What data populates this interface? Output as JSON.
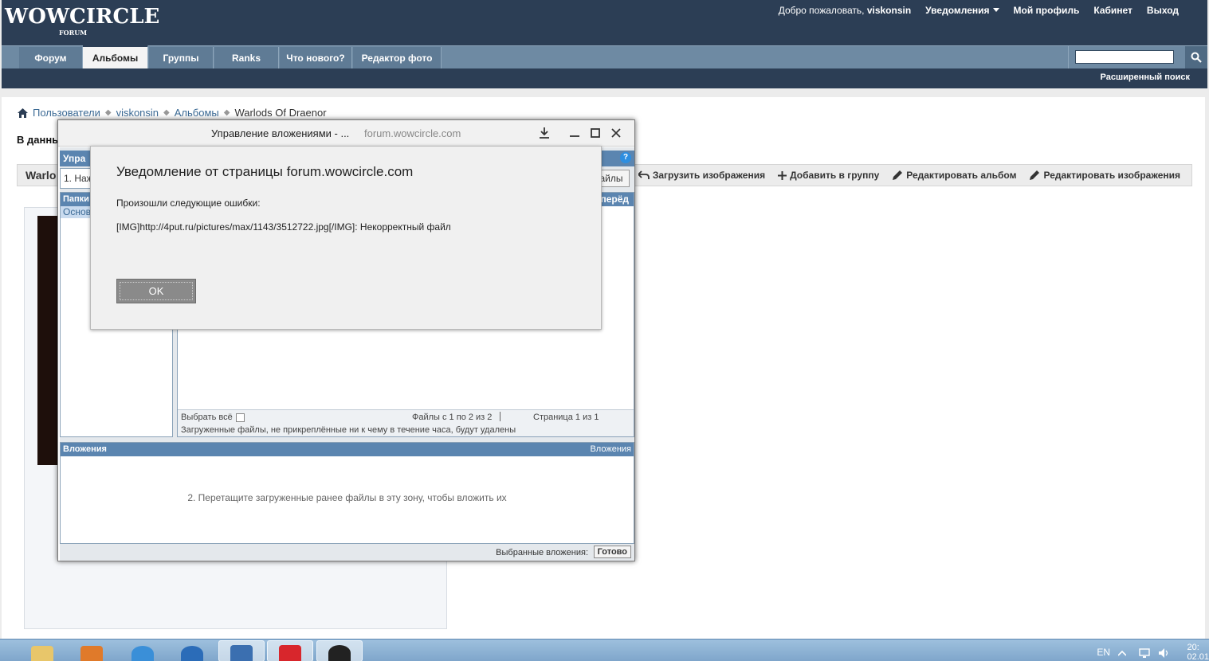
{
  "header": {
    "logo": "WOWCIRCLE",
    "logo_sub": "FORUM",
    "welcome_prefix": "Добро пожаловать,",
    "username": "viskonsin",
    "notifications": "Уведомления",
    "my_profile": "Мой профиль",
    "cabinet": "Кабинет",
    "logout": "Выход"
  },
  "nav": {
    "tabs": [
      {
        "label": "Форум"
      },
      {
        "label": "Альбомы"
      },
      {
        "label": "Группы"
      },
      {
        "label": "Ranks"
      },
      {
        "label": "Что нового?"
      },
      {
        "label": "Редактор фото"
      }
    ],
    "advanced_search": "Расширенный поиск"
  },
  "breadcrumb": {
    "items": [
      "Пользователи",
      "viskonsin",
      "Альбомы",
      "Warlods Of Draenor"
    ]
  },
  "page": {
    "intro": "В данны",
    "album_title": "Warlo",
    "actions": {
      "upload": "Загрузить изображения",
      "add_group": "Добавить в группу",
      "edit_album": "Редактировать альбом",
      "edit_images": "Редактировать изображения"
    }
  },
  "attach_window": {
    "title": "Управление вложениями - ...",
    "url": "forum.wowcircle.com",
    "manage_head": "Упра",
    "step1": "1. Наж",
    "files_button": "айлы",
    "help": "?",
    "folders_head": "Папки",
    "folder_main": "Основ",
    "next_tab": "перёд",
    "select_all": "Выбрать всё",
    "files_count": "Файлы с 1 по 2 из 2",
    "page_count": "Страница 1 из 1",
    "files_note": "Загруженные файлы, не прикреплённые ни к чему в течение часа, будут удалены",
    "attachments_head": "Вложения",
    "attachments_head_right": "Вложения",
    "drop_hint": "2. Перетащите загруженные ранее файлы в эту зону, чтобы вложить их",
    "selected_label": "Выбранные вложения:",
    "done": "Готово"
  },
  "alert": {
    "title": "Уведомление от страницы forum.wowcircle.com",
    "message1": "Произошли следующие ошибки:",
    "message2": "[IMG]http://4put.ru/pictures/max/1143/3512722.jpg[/IMG]: Некорректный файл",
    "ok": "OK"
  },
  "taskbar": {
    "lang": "EN",
    "clock": "20:",
    "clock2": "02.01",
    "apps": [
      "explorer-icon",
      "media-player-icon",
      "internet-explorer-icon",
      "chrome-icon",
      "browser-app-icon",
      "yandex-browser-icon",
      "camera-app-icon"
    ]
  },
  "colors": {
    "header_dark": "#2c3e55",
    "nav_bar": "#6e8aa3",
    "panel_blue": "#5b85b0",
    "link": "#3b6a95"
  }
}
